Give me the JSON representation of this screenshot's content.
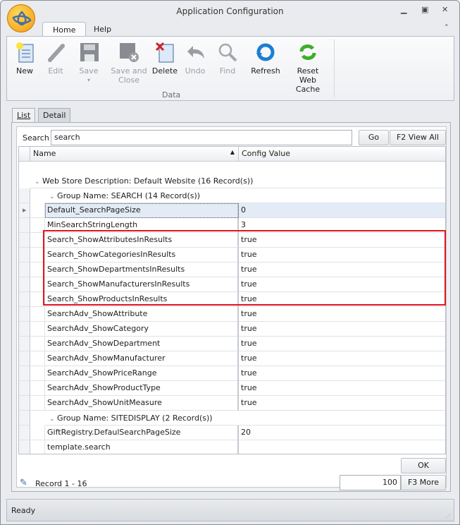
{
  "window": {
    "title": "Application Configuration"
  },
  "ribbon_tabs": [
    {
      "label": "Home"
    },
    {
      "label": "Help"
    }
  ],
  "ribbon": {
    "group_label": "Data",
    "buttons": [
      {
        "label": "New",
        "enabled": true
      },
      {
        "label": "Edit",
        "enabled": false
      },
      {
        "label": "Save",
        "enabled": false
      },
      {
        "label": "Save and Close",
        "enabled": false
      },
      {
        "label": "Delete",
        "enabled": true
      },
      {
        "label": "Undo",
        "enabled": false
      },
      {
        "label": "Find",
        "enabled": false
      },
      {
        "label": "Refresh",
        "enabled": true
      },
      {
        "label": "Reset Web Cache",
        "enabled": true
      }
    ]
  },
  "panel_tabs": [
    {
      "label": "List"
    },
    {
      "label": "Detail"
    }
  ],
  "search": {
    "label": "Search",
    "value": "search",
    "go": "Go",
    "view_all": "F2 View All"
  },
  "grid": {
    "columns": [
      "Name",
      "Config Value"
    ],
    "group1": "Web Store Description: Default Website (16 Record(s))",
    "group2": "Group Name: SEARCH (14 Record(s))",
    "group3": "Group Name: SITEDISPLAY (2 Record(s))",
    "search_rows": [
      {
        "name": "Default_SearchPageSize",
        "value": "0"
      },
      {
        "name": "MinSearchStringLength",
        "value": "3"
      },
      {
        "name": "Search_ShowAttributesInResults",
        "value": "true"
      },
      {
        "name": "Search_ShowCategoriesInResults",
        "value": "true"
      },
      {
        "name": "Search_ShowDepartmentsInResults",
        "value": "true"
      },
      {
        "name": "Search_ShowManufacturersInResults",
        "value": "true"
      },
      {
        "name": "Search_ShowProductsInResults",
        "value": "true"
      },
      {
        "name": "SearchAdv_ShowAttribute",
        "value": "true"
      },
      {
        "name": "SearchAdv_ShowCategory",
        "value": "true"
      },
      {
        "name": "SearchAdv_ShowDepartment",
        "value": "true"
      },
      {
        "name": "SearchAdv_ShowManufacturer",
        "value": "true"
      },
      {
        "name": "SearchAdv_ShowPriceRange",
        "value": "true"
      },
      {
        "name": "SearchAdv_ShowProductType",
        "value": "true"
      },
      {
        "name": "SearchAdv_ShowUnitMeasure",
        "value": "true"
      }
    ],
    "sitedisplay_rows": [
      {
        "name": "GiftRegistry.DefaulSearchPageSize",
        "value": "20"
      },
      {
        "name": "template.search",
        "value": ""
      }
    ]
  },
  "footer": {
    "ok": "OK",
    "record_label": "Record 1 - 16",
    "page_size": "100",
    "more": "F3 More"
  },
  "status": "Ready"
}
